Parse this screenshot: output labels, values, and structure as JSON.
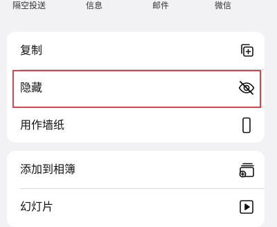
{
  "share_targets": [
    {
      "label": "隔空投送",
      "icon": "airdrop-icon"
    },
    {
      "label": "信息",
      "icon": "messages-icon"
    },
    {
      "label": "邮件",
      "icon": "mail-icon"
    },
    {
      "label": "微信",
      "icon": "wechat-icon"
    }
  ],
  "actions_primary": [
    {
      "label": "复制",
      "icon": "copy-icon"
    },
    {
      "label": "隐藏",
      "icon": "eye-slash-icon"
    },
    {
      "label": "用作墙纸",
      "icon": "phone-icon"
    }
  ],
  "actions_secondary": [
    {
      "label": "添加到相簿",
      "icon": "add-to-album-icon"
    },
    {
      "label": "幻灯片",
      "icon": "play-icon"
    }
  ],
  "colors": {
    "background": "#f2f2f4",
    "card": "#ffffff",
    "highlight_border": "#e0424a"
  }
}
